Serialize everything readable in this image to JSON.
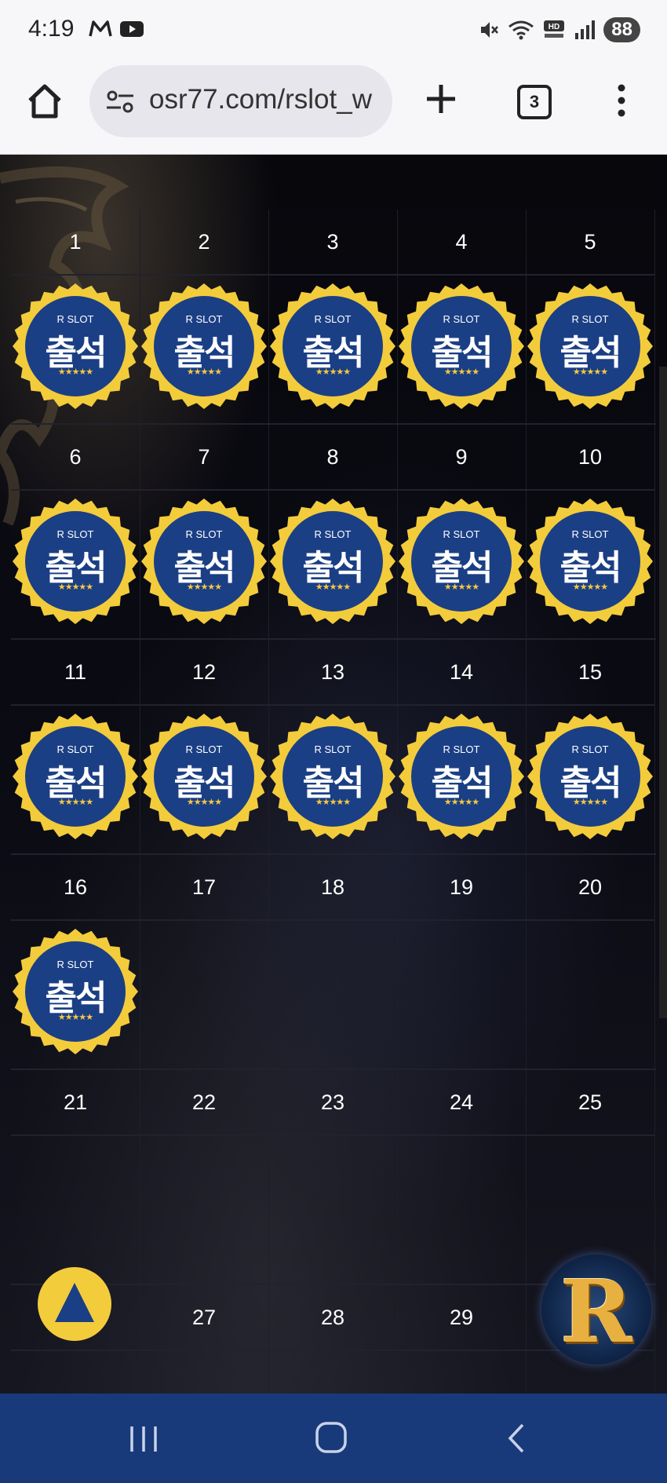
{
  "status_bar": {
    "time": "4:19",
    "battery": "88"
  },
  "browser": {
    "url": "osr77.com/rslot_w",
    "tab_count": "3"
  },
  "calendar": {
    "stamp_brand": "R SLOT",
    "stamp_text": "출석",
    "stamp_stars": "★★★★★",
    "days": [
      {
        "day": "1",
        "checked": true
      },
      {
        "day": "2",
        "checked": true
      },
      {
        "day": "3",
        "checked": true
      },
      {
        "day": "4",
        "checked": true
      },
      {
        "day": "5",
        "checked": true
      },
      {
        "day": "6",
        "checked": true
      },
      {
        "day": "7",
        "checked": true
      },
      {
        "day": "8",
        "checked": true
      },
      {
        "day": "9",
        "checked": true
      },
      {
        "day": "10",
        "checked": true
      },
      {
        "day": "11",
        "checked": true
      },
      {
        "day": "12",
        "checked": true
      },
      {
        "day": "13",
        "checked": true
      },
      {
        "day": "14",
        "checked": true
      },
      {
        "day": "15",
        "checked": true
      },
      {
        "day": "16",
        "checked": true
      },
      {
        "day": "17",
        "checked": false
      },
      {
        "day": "18",
        "checked": false
      },
      {
        "day": "19",
        "checked": false
      },
      {
        "day": "20",
        "checked": false
      },
      {
        "day": "21",
        "checked": false
      },
      {
        "day": "22",
        "checked": false
      },
      {
        "day": "23",
        "checked": false
      },
      {
        "day": "24",
        "checked": false
      },
      {
        "day": "25",
        "checked": false
      },
      {
        "day": "",
        "checked": false
      },
      {
        "day": "27",
        "checked": false
      },
      {
        "day": "28",
        "checked": false
      },
      {
        "day": "29",
        "checked": false
      },
      {
        "day": "",
        "checked": false
      }
    ]
  },
  "floating": {
    "logo_letter": "R"
  },
  "colors": {
    "stamp_blue": "#1b3f85",
    "stamp_gold": "#f3cc3c",
    "nav_bar": "#183a7a"
  }
}
